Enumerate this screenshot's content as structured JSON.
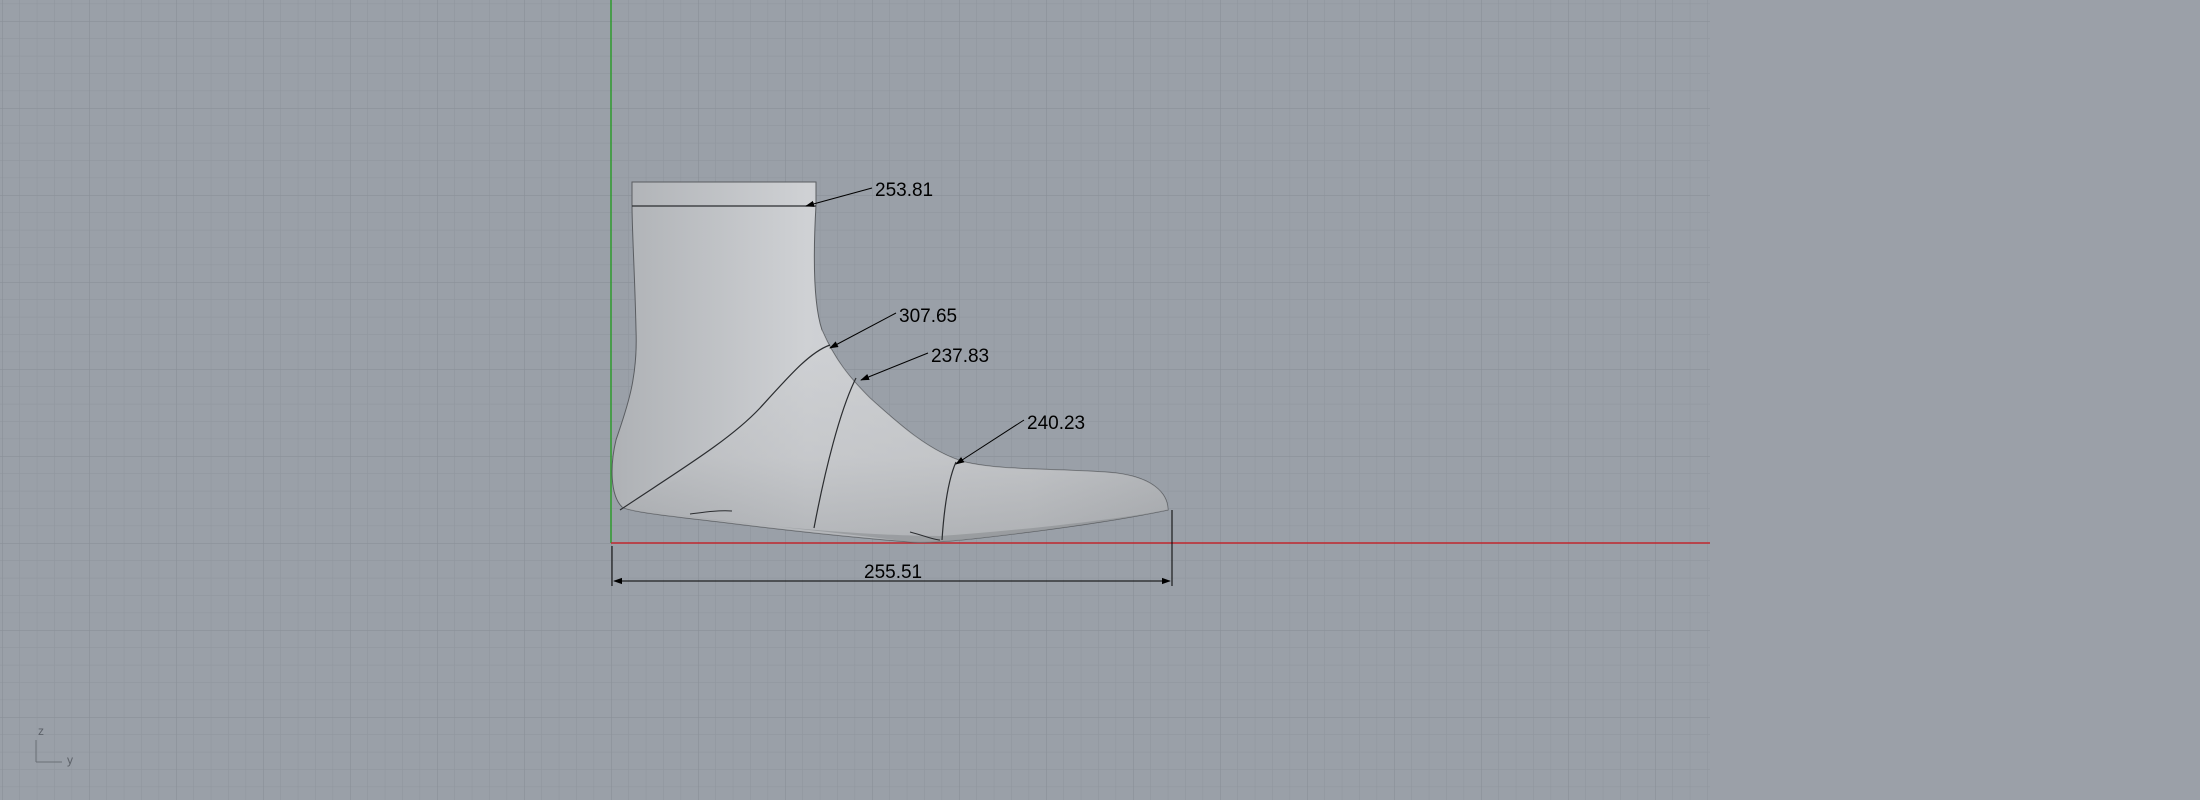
{
  "viewport": {
    "background_color": "#9aa0a8",
    "grid_minor_color": "#8e949c",
    "grid_major_color": "#858b93",
    "x_axis_color": "#c0272d",
    "y_axis_color": "#2e9a2e",
    "model_color": "#c4c6c9"
  },
  "dimensions": {
    "top_girth": "253.81",
    "instep_girth": "307.65",
    "ankle_girth": "237.83",
    "ball_girth": "240.23",
    "length": "255.51"
  },
  "axis_gizmo": {
    "z_label": "z",
    "y_label": "y"
  }
}
